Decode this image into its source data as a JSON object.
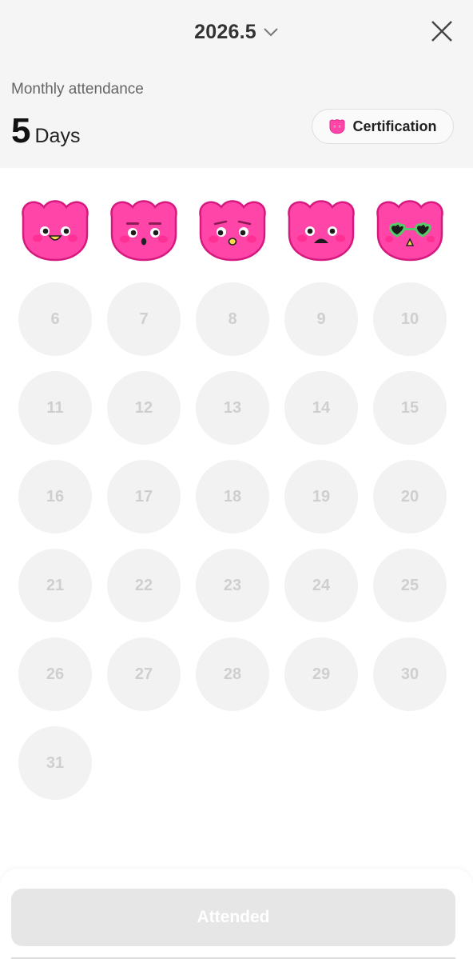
{
  "header": {
    "month": "2026.5",
    "attendance_label": "Monthly attendance",
    "attendance_count": "5",
    "attendance_unit": "Days",
    "certification_label": "Certification"
  },
  "calendar": {
    "stamped_days": [
      {
        "day": 1,
        "face": "happy-smile"
      },
      {
        "day": 2,
        "face": "surprised-flat-brows"
      },
      {
        "day": 3,
        "face": "worried-tongue"
      },
      {
        "day": 4,
        "face": "sad-frown"
      },
      {
        "day": 5,
        "face": "heart-sunglasses"
      }
    ],
    "days": [
      "6",
      "7",
      "8",
      "9",
      "10",
      "11",
      "12",
      "13",
      "14",
      "15",
      "16",
      "17",
      "18",
      "19",
      "20",
      "21",
      "22",
      "23",
      "24",
      "25",
      "26",
      "27",
      "28",
      "29",
      "30",
      "31"
    ]
  },
  "footer": {
    "attended_label": "Attended"
  },
  "colors": {
    "stamp_pink": "#ff45a8",
    "stamp_outline": "#d6197e",
    "cheek": "#ff2f93",
    "empty_circle": "#f2f2f2",
    "day_text": "#cfcfcf",
    "header_bg": "#f5f5f5",
    "button_disabled": "#e6e6e6"
  }
}
